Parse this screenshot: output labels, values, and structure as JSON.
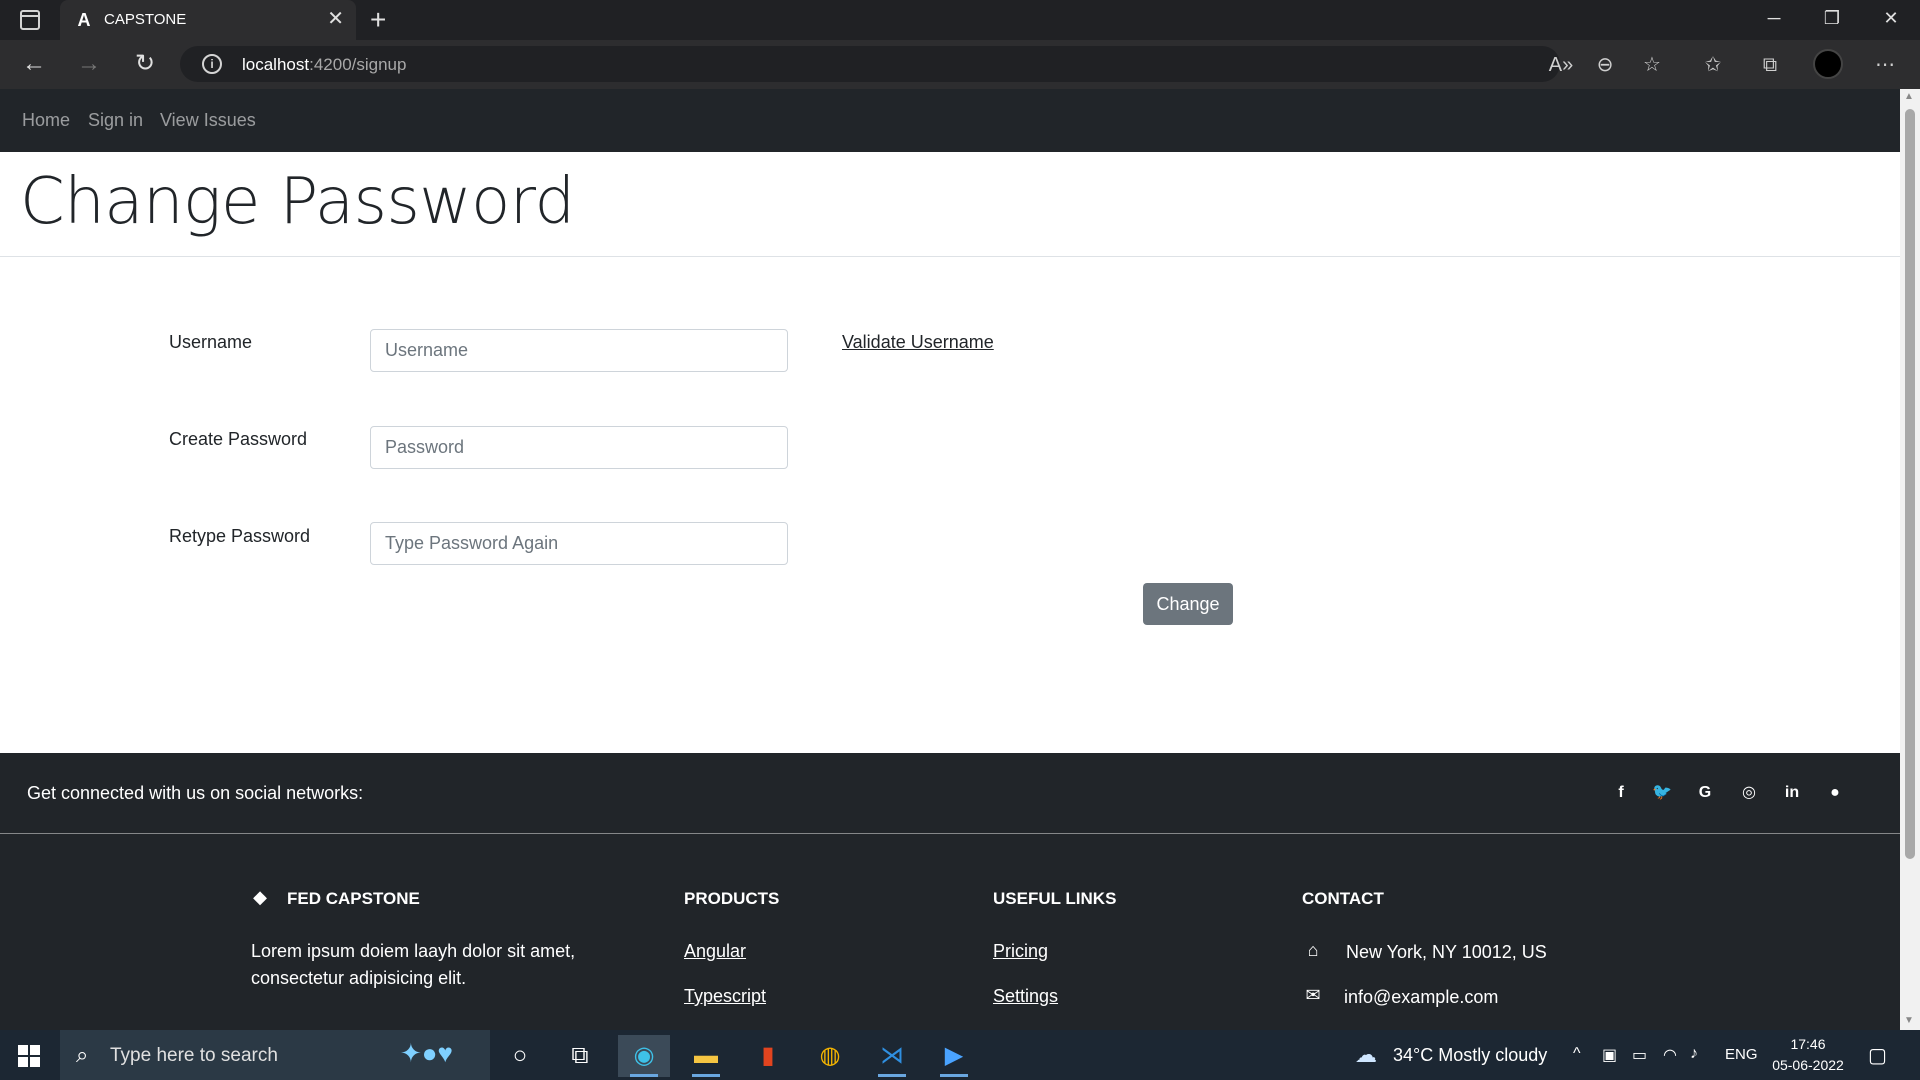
{
  "browser": {
    "tab_title": "CAPSTONE",
    "favicon_letter": "A",
    "url_host": "localhost",
    "url_rest": ":4200/signup"
  },
  "nav": {
    "links": [
      "Home",
      "Sign in",
      "View Issues"
    ]
  },
  "page": {
    "title": "Change Password"
  },
  "form": {
    "username_label": "Username",
    "username_placeholder": "Username",
    "validate_link": "Validate Username",
    "password_label": "Create Password",
    "password_placeholder": "Password",
    "retype_label": "Retype Password",
    "retype_placeholder": "Type Password Again",
    "submit_label": "Change"
  },
  "footer": {
    "social_text": "Get connected with us on social networks:",
    "social_icons": [
      "facebook-icon",
      "twitter-icon",
      "google-icon",
      "instagram-icon",
      "linkedin-icon",
      "github-icon"
    ],
    "brand": {
      "title": "FED CAPSTONE",
      "text": "Lorem ipsum doiem laayh dolor sit amet, consectetur adipisicing elit."
    },
    "products": {
      "heading": "PRODUCTS",
      "links": [
        "Angular",
        "Typescript"
      ]
    },
    "useful_links": {
      "heading": "USEFUL LINKS",
      "links": [
        "Pricing",
        "Settings"
      ]
    },
    "contact": {
      "heading": "CONTACT",
      "address": "New York, NY 10012, US",
      "email": "info@example.com"
    }
  },
  "taskbar": {
    "search_placeholder": "Type here to search",
    "weather": "34°C  Mostly cloudy",
    "language": "ENG",
    "time": "17:46",
    "date": "05-06-2022"
  },
  "colors": {
    "navbar_bg": "#212529",
    "button_bg": "#6c757d",
    "taskbar_bg": "#1c2733"
  }
}
